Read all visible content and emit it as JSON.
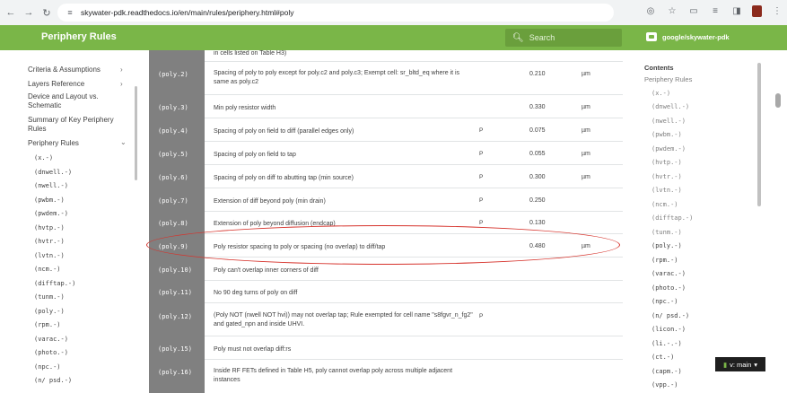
{
  "browser": {
    "url": "skywater-pdk.readthedocs.io/en/main/rules/periphery.html#poly"
  },
  "header": {
    "title": "Periphery Rules",
    "search_placeholder": "Search",
    "repo_label": "google/skywater-pdk"
  },
  "sidebar": {
    "items": [
      {
        "label": "Criteria & Assumptions",
        "chevron": "›"
      },
      {
        "label": "Layers Reference",
        "chevron": "›"
      },
      {
        "label": "Device and Layout vs.\nSchematic",
        "chevron": ""
      },
      {
        "label": "Summary of Key Periphery\nRules",
        "chevron": ""
      },
      {
        "label": "Periphery Rules",
        "chevron": "⌄"
      }
    ],
    "sub_items": [
      "(x.-)",
      "(dnwell.-)",
      "(nwell.-)",
      "(pwbm.-)",
      "(pwdem.-)",
      "(hvtp.-)",
      "(hvtr.-)",
      "(lvtn.-)",
      "(ncm.-)",
      "(difftap.-)",
      "(tunm.-)",
      "(poly.-)",
      "(rpm.-)",
      "(varac.-)",
      "(photo.-)",
      "(npc.-)",
      "(n/ psd.-)"
    ]
  },
  "main": {
    "top_cut_text": "in cells listed on Table H3)",
    "rows": [
      {
        "id": "(poly.2)",
        "desc": "Spacing of poly to poly except for poly.c2 and poly.c3; Exempt cell: sr_bltd_eq where it is same as poly.c2",
        "flag": "",
        "value": "0.210",
        "unit": "µm"
      },
      {
        "id": "(poly.3)",
        "desc": "Min poly resistor width",
        "flag": "",
        "value": "0.330",
        "unit": "µm"
      },
      {
        "id": "(poly.4)",
        "desc": "Spacing of poly on field to diff (parallel edges only)",
        "flag": "P",
        "value": "0.075",
        "unit": "µm"
      },
      {
        "id": "(poly.5)",
        "desc": "Spacing of poly on field to tap",
        "flag": "P",
        "value": "0.055",
        "unit": "µm"
      },
      {
        "id": "(poly.6)",
        "desc": "Spacing of poly on diff to abutting tap (min source)",
        "flag": "P",
        "value": "0.300",
        "unit": "µm"
      },
      {
        "id": "(poly.7)",
        "desc": "Extension of diff beyond poly (min drain)",
        "flag": "P",
        "value": "0.250",
        "unit": ""
      },
      {
        "id": "(poly.8)",
        "desc": "Extension of poly beyond diffusion (endcap)",
        "flag": "P",
        "value": "0.130",
        "unit": ""
      },
      {
        "id": "(poly.9)",
        "desc": "Poly resistor spacing to poly or spacing (no overlap) to diff/tap",
        "flag": "",
        "value": "0.480",
        "unit": "µm"
      },
      {
        "id": "(poly.10)",
        "desc": "Poly can't overlap inner corners of diff",
        "flag": "",
        "value": "",
        "unit": ""
      },
      {
        "id": "(poly.11)",
        "desc": "No 90 deg turns of poly on diff",
        "flag": "",
        "value": "",
        "unit": ""
      },
      {
        "id": "(poly.12)",
        "desc": "(Poly NOT (nwell NOT hvi)) may not overlap tap; Rule exempted for cell name \"s8fgvr_n_fg2\" and gated_npn and inside UHVI.",
        "flag": "P",
        "value": "",
        "unit": ""
      },
      {
        "id": "(poly.15)",
        "desc": "Poly must not overlap diff:rs",
        "flag": "",
        "value": "",
        "unit": ""
      },
      {
        "id": "(poly.16)",
        "desc": "Inside RF FETs defined in Table H5, poly cannot overlap poly across multiple adjacent instances",
        "flag": "",
        "value": "",
        "unit": ""
      }
    ]
  },
  "toc": {
    "heading": "Contents",
    "section": "Periphery Rules",
    "items": [
      "(x.-)",
      "(dnwell.-)",
      "(nwell.-)",
      "(pwbm.-)",
      "(pwdem.-)",
      "(hvtp.-)",
      "(hvtr.-)",
      "(lvtn.-)",
      "(ncm.-)",
      "(difftap.-)",
      "(tunm.-)",
      "(poly.-)",
      "(rpm.-)",
      "(varac.-)",
      "(photo.-)",
      "(npc.-)",
      "(n/ psd.-)",
      "(licon.-)",
      "(li.-.-)",
      "(ct.-)",
      "(capm.-)",
      "(vpp.-)"
    ]
  },
  "version_badge": {
    "label": "v: main",
    "caret": "▾"
  },
  "colors": {
    "header_green": "#7ab648",
    "annotation_red": "#d6322b"
  }
}
